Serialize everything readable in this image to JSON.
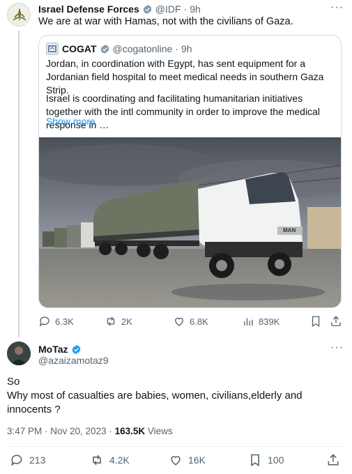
{
  "tweet1": {
    "author_name": "Israel Defense Forces",
    "handle": "@IDF",
    "separator": "·",
    "time": "9h",
    "text": "We are at war with Hamas, not with the civilians of Gaza."
  },
  "quote": {
    "author_name": "COGAT",
    "handle": "@cogatonline",
    "separator": "·",
    "time": "9h",
    "text_para1": "Jordan, in coordination with Egypt, has sent equipment for a Jordanian field hospital to meet medical needs in southern Gaza Strip.",
    "text_para2": "Israel is coordinating and facilitating humanitarian initiatives together with the intl community in order to improve the medical response in …",
    "show_more": "Show more",
    "image_logo_text": "MAN"
  },
  "tweet1_actions": {
    "replies": "6.3K",
    "reposts": "2K",
    "likes": "6.8K",
    "views": "839K"
  },
  "tweet2": {
    "author_name": "MoTaz",
    "handle": "@azaizamotaz9",
    "text_line1": "So",
    "text_line2": "Why most of casualties are babies, women, civilians,elderly and innocents ?",
    "timestamp": "3:47 PM · Nov 20, 2023 · ",
    "views_count": "163.5K",
    "views_label": " Views"
  },
  "tweet2_actions": {
    "replies": "213",
    "reposts": "4.2K",
    "likes": "16K",
    "bookmarks": "100"
  },
  "colors": {
    "verified_blue": "#1d9bf0",
    "link_blue": "#1d9bf0",
    "muted": "#536471",
    "border": "#cfd9de"
  },
  "icons": [
    "more-icon",
    "verified-icon",
    "reply-icon",
    "repost-icon",
    "like-icon",
    "views-icon",
    "bookmark-icon",
    "share-icon"
  ]
}
